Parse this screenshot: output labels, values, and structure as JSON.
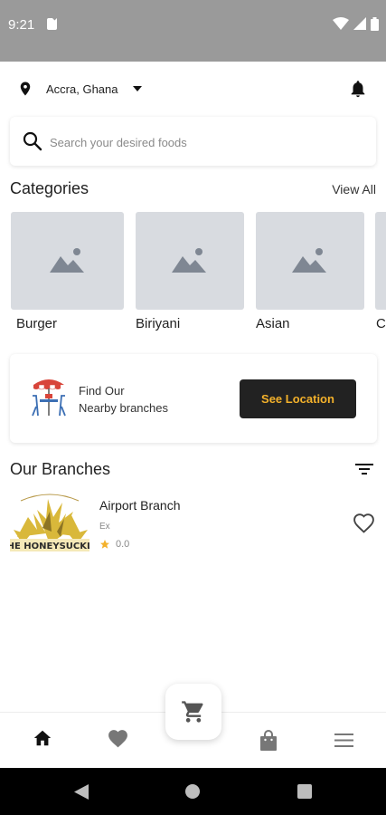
{
  "status_bar": {
    "time": "9:21"
  },
  "header": {
    "location": "Accra, Ghana"
  },
  "search": {
    "placeholder": "Search your desired foods",
    "value": ""
  },
  "categories": {
    "title": "Categories",
    "view_all": "View All",
    "items": [
      {
        "label": "Burger"
      },
      {
        "label": "Biriyani"
      },
      {
        "label": "Asian"
      },
      {
        "label": "C"
      }
    ]
  },
  "nearby": {
    "line1": "Find Our",
    "line2": "Nearby branches",
    "button": "See Location"
  },
  "branches": {
    "title": "Our Branches",
    "items": [
      {
        "name": "Airport Branch",
        "subtitle": "Ex",
        "rating": "0.0",
        "logo_text": "HE HONEYSUCKL"
      }
    ]
  },
  "colors": {
    "accent": "#f3b12b",
    "dark": "#222222",
    "placeholder_bg": "#d8dbe0"
  }
}
